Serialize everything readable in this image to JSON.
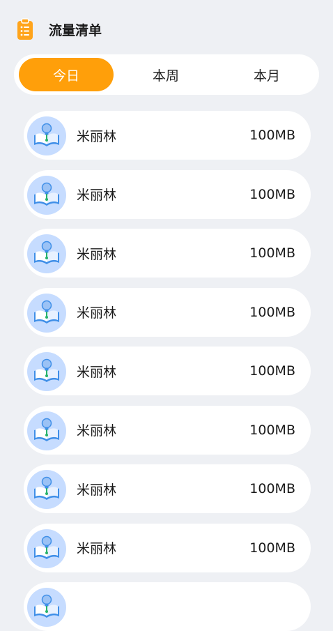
{
  "header": {
    "title": "流量清单",
    "icon": "clipboard-list-icon"
  },
  "tabs": [
    {
      "label": "今日",
      "active": true
    },
    {
      "label": "本周",
      "active": false
    },
    {
      "label": "本月",
      "active": false
    }
  ],
  "colors": {
    "accent": "#ff9f0a",
    "background": "#eef0f4",
    "card": "#ffffff",
    "avatar_bg": "#c6dcff"
  },
  "items": [
    {
      "name": "米丽林",
      "usage": "100MB",
      "icon": "book-lightbulb-icon"
    },
    {
      "name": "米丽林",
      "usage": "100MB",
      "icon": "book-lightbulb-icon"
    },
    {
      "name": "米丽林",
      "usage": "100MB",
      "icon": "book-lightbulb-icon"
    },
    {
      "name": "米丽林",
      "usage": "100MB",
      "icon": "book-lightbulb-icon"
    },
    {
      "name": "米丽林",
      "usage": "100MB",
      "icon": "book-lightbulb-icon"
    },
    {
      "name": "米丽林",
      "usage": "100MB",
      "icon": "book-lightbulb-icon"
    },
    {
      "name": "米丽林",
      "usage": "100MB",
      "icon": "book-lightbulb-icon"
    },
    {
      "name": "米丽林",
      "usage": "100MB",
      "icon": "book-lightbulb-icon"
    },
    {
      "name": "",
      "usage": "",
      "icon": "book-lightbulb-icon"
    }
  ]
}
